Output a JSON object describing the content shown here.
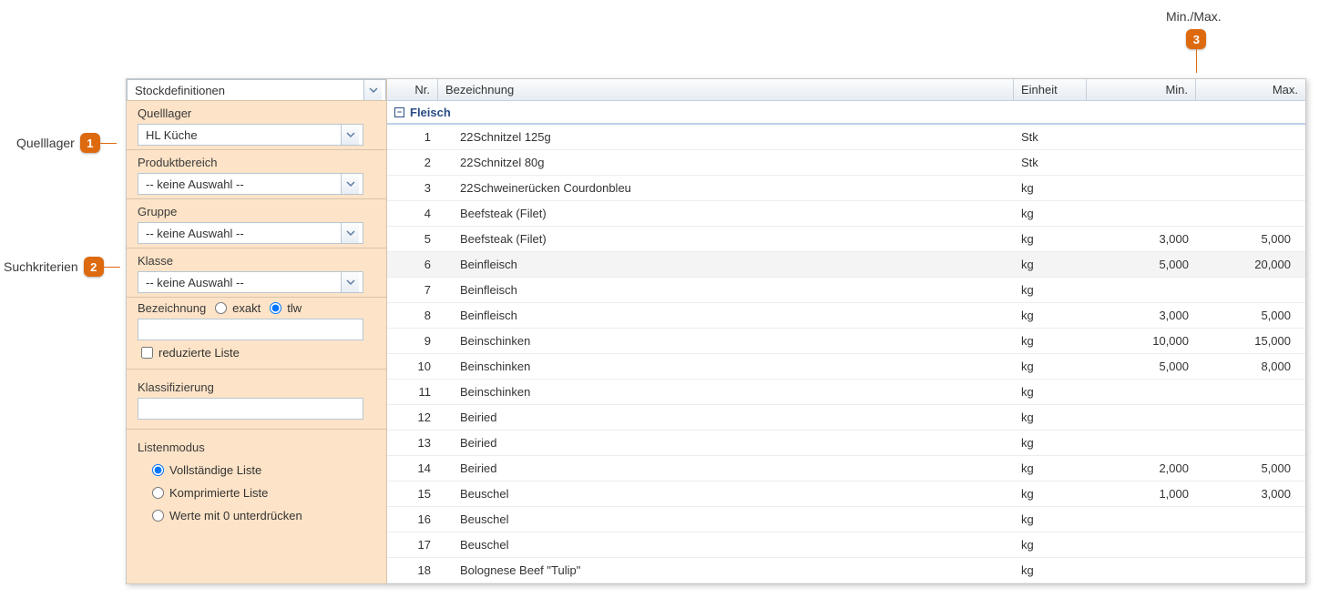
{
  "callouts": {
    "c1_label": "Quelllager",
    "c1_num": "1",
    "c2_label": "Suchkriterien",
    "c2_num": "2",
    "c3_label": "Min./Max.",
    "c3_num": "3"
  },
  "sidebar": {
    "main_dd": "Stockdefinitionen",
    "quelllager_label": "Quelllager",
    "quelllager_value": "HL Küche",
    "produktbereich_label": "Produktbereich",
    "produktbereich_value": "-- keine Auswahl --",
    "gruppe_label": "Gruppe",
    "gruppe_value": "-- keine Auswahl --",
    "klasse_label": "Klasse",
    "klasse_value": "-- keine Auswahl --",
    "bezeichnung_label": "Bezeichnung",
    "exakt_label": "exakt",
    "tlw_label": "tlw",
    "reduzierte_label": "reduzierte Liste",
    "klassifizierung_label": "Klassifizierung",
    "listenmodus_label": "Listenmodus",
    "lm_voll": "Vollständige Liste",
    "lm_komp": "Komprimierte Liste",
    "lm_werte0": "Werte mit 0 unterdrücken"
  },
  "table": {
    "headers": {
      "nr": "Nr.",
      "bez": "Bezeichnung",
      "einh": "Einheit",
      "min": "Min.",
      "max": "Max."
    },
    "group": "Fleisch",
    "rows": [
      {
        "nr": "1",
        "bez": "22Schnitzel 125g",
        "einh": "Stk",
        "min": "",
        "max": ""
      },
      {
        "nr": "2",
        "bez": "22Schnitzel 80g",
        "einh": "Stk",
        "min": "",
        "max": ""
      },
      {
        "nr": "3",
        "bez": "22Schweinerücken Courdonbleu",
        "einh": "kg",
        "min": "",
        "max": ""
      },
      {
        "nr": "4",
        "bez": "Beefsteak (Filet)",
        "einh": "kg",
        "min": "",
        "max": ""
      },
      {
        "nr": "5",
        "bez": "Beefsteak (Filet)",
        "einh": "kg",
        "min": "3,000",
        "max": "5,000"
      },
      {
        "nr": "6",
        "bez": "Beinfleisch",
        "einh": "kg",
        "min": "5,000",
        "max": "20,000"
      },
      {
        "nr": "7",
        "bez": "Beinfleisch",
        "einh": "kg",
        "min": "",
        "max": ""
      },
      {
        "nr": "8",
        "bez": "Beinfleisch",
        "einh": "kg",
        "min": "3,000",
        "max": "5,000"
      },
      {
        "nr": "9",
        "bez": "Beinschinken",
        "einh": "kg",
        "min": "10,000",
        "max": "15,000"
      },
      {
        "nr": "10",
        "bez": "Beinschinken",
        "einh": "kg",
        "min": "5,000",
        "max": "8,000"
      },
      {
        "nr": "11",
        "bez": "Beinschinken",
        "einh": "kg",
        "min": "",
        "max": ""
      },
      {
        "nr": "12",
        "bez": "Beiried",
        "einh": "kg",
        "min": "",
        "max": ""
      },
      {
        "nr": "13",
        "bez": "Beiried",
        "einh": "kg",
        "min": "",
        "max": ""
      },
      {
        "nr": "14",
        "bez": "Beiried",
        "einh": "kg",
        "min": "2,000",
        "max": "5,000"
      },
      {
        "nr": "15",
        "bez": "Beuschel",
        "einh": "kg",
        "min": "1,000",
        "max": "3,000"
      },
      {
        "nr": "16",
        "bez": "Beuschel",
        "einh": "kg",
        "min": "",
        "max": ""
      },
      {
        "nr": "17",
        "bez": "Beuschel",
        "einh": "kg",
        "min": "",
        "max": ""
      },
      {
        "nr": "18",
        "bez": "Bolognese Beef \"Tulip\"",
        "einh": "kg",
        "min": "",
        "max": ""
      }
    ]
  }
}
